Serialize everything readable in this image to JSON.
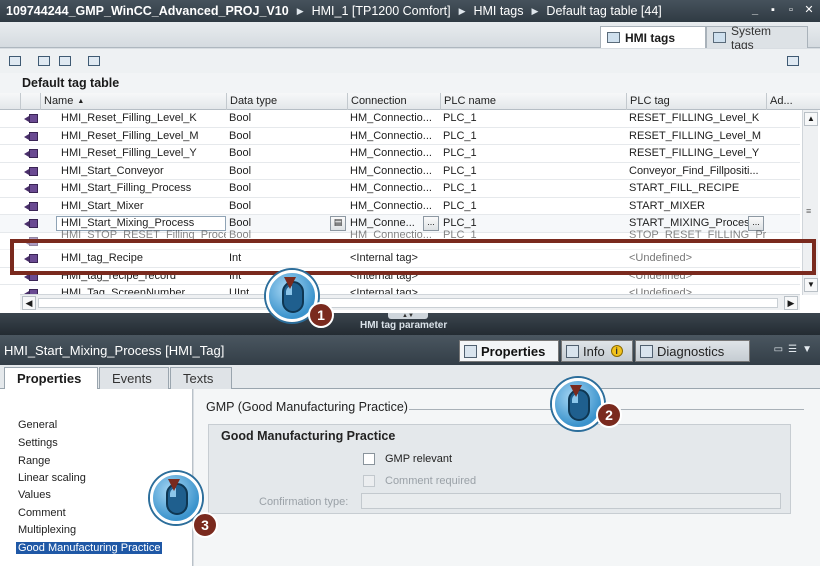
{
  "titlebar": {
    "crumbs": [
      "109744244_GMP_WinCC_Advanced_PROJ_V10",
      "HMI_1 [TP1200 Comfort]",
      "HMI tags",
      "Default tag table [44]"
    ],
    "controls": [
      "_",
      "▪",
      "▫",
      "✕"
    ]
  },
  "tabs": {
    "hmi_tags": "HMI tags",
    "system_tags": "System tags"
  },
  "table": {
    "title": "Default tag table",
    "columns": {
      "name": "Name",
      "data_type": "Data type",
      "connection": "Connection",
      "plc_name": "PLC name",
      "plc_tag": "PLC tag",
      "address": "Ad..."
    },
    "rows": [
      {
        "name": "HMI_Reset_Filling_Level_K",
        "type": "Bool",
        "conn": "HM_Connectio...",
        "plc": "PLC_1",
        "tag": "RESET_FILLING_Level_K"
      },
      {
        "name": "HMI_Reset_Filling_Level_M",
        "type": "Bool",
        "conn": "HM_Connectio...",
        "plc": "PLC_1",
        "tag": "RESET_FILLING_Level_M"
      },
      {
        "name": "HMI_Reset_Filling_Level_Y",
        "type": "Bool",
        "conn": "HM_Connectio...",
        "plc": "PLC_1",
        "tag": "RESET_FILLING_Level_Y"
      },
      {
        "name": "HMI_Start_Conveyor",
        "type": "Bool",
        "conn": "HM_Connectio...",
        "plc": "PLC_1",
        "tag": "Conveyor_Find_Fillpositi..."
      },
      {
        "name": "HMI_Start_Filling_Process",
        "type": "Bool",
        "conn": "HM_Connectio...",
        "plc": "PLC_1",
        "tag": "START_FILL_RECIPE"
      },
      {
        "name": "HMI_Start_Mixer",
        "type": "Bool",
        "conn": "HM_Connectio...",
        "plc": "PLC_1",
        "tag": "START_MIXER"
      },
      {
        "name": "HMI_Start_Mixing_Process",
        "type": "Bool",
        "conn": "HM_Conne...",
        "plc": "PLC_1",
        "tag": "START_MIXING_Process"
      },
      {
        "name": "HMI_STOP_RESET_Filling_Process",
        "type": "Bool",
        "conn": "HM_Connectio...",
        "plc": "PLC_1",
        "tag": "STOP_RESET_FILLING_Pr..."
      },
      {
        "name": "HMI_tag_Recipe",
        "type": "Int",
        "conn": "<Internal tag>",
        "plc": "",
        "tag": "<Undefined>"
      },
      {
        "name": "HMI_tag_recipe_record",
        "type": "Int",
        "conn": "<Internal tag>",
        "plc": "",
        "tag": "<Undefined>"
      },
      {
        "name": "HMI_Tag_ScreenNumber",
        "type": "UInt",
        "conn": "<Internal tag>",
        "plc": "",
        "tag": "<Undefined>"
      }
    ],
    "splitter_label": "HMI tag parameter"
  },
  "inspector": {
    "title": "HMI_Start_Mixing_Process [HMI_Tag]",
    "tabs": {
      "properties": "Properties",
      "info": "Info",
      "info_badge": "i",
      "diagnostics": "Diagnostics"
    },
    "subtabs": {
      "properties": "Properties",
      "events": "Events",
      "texts": "Texts"
    },
    "nav": [
      "General",
      "Settings",
      "Range",
      "Linear scaling",
      "Values",
      "Comment",
      "Multiplexing",
      "Good Manufacturing Practice"
    ],
    "section_title": "GMP (Good Manufacturing Practice)",
    "group_title": "Good Manufacturing Practice",
    "gmp_relevant": "GMP relevant",
    "comment_required": "Comment required",
    "confirmation_type": "Confirmation type:"
  },
  "callouts": [
    "1",
    "2",
    "3"
  ]
}
